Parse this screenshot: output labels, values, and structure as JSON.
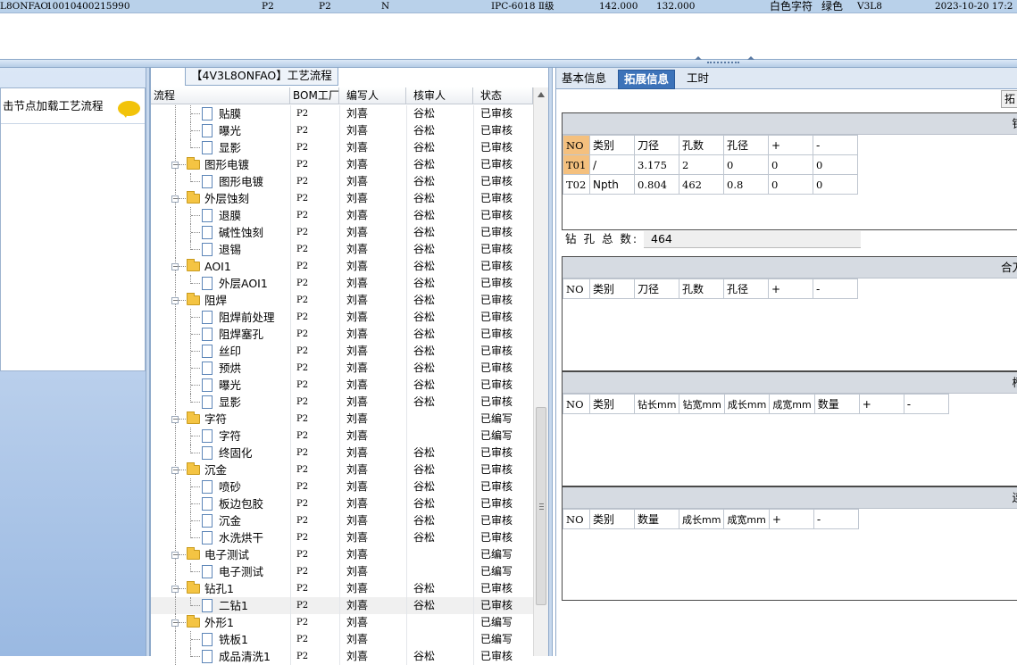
{
  "top_row": {
    "code": "L8ONFAO",
    "number": "10010400215990",
    "f1": "P2",
    "f2": "P2",
    "f3": "N",
    "standard": "IPC-6018 Ⅱ级",
    "v1": "142.000",
    "v2": "132.000",
    "silk": "白色字符",
    "mask": "绿色",
    "version": "V3L8",
    "datetime": "2023-10-20 17:2"
  },
  "left_panel": {
    "hint": "击节点加载工艺流程",
    "icon": "chat-bubble-icon"
  },
  "tree_panel": {
    "title": "【4V3L8ONFAO】工艺流程",
    "columns": {
      "flow": "流程",
      "bom": "BOM工厂",
      "writer": "编写人",
      "checker": "核审人",
      "status": "状态"
    },
    "rows": [
      {
        "name": "贴膜",
        "level": 2,
        "bom": "P2",
        "writer": "刘喜",
        "checker": "谷松",
        "status": "已审核"
      },
      {
        "name": "曝光",
        "level": 2,
        "bom": "P2",
        "writer": "刘喜",
        "checker": "谷松",
        "status": "已审核"
      },
      {
        "name": "显影",
        "level": 2,
        "bom": "P2",
        "writer": "刘喜",
        "checker": "谷松",
        "status": "已审核"
      },
      {
        "name": "图形电镀",
        "level": 1,
        "bom": "P2",
        "writer": "刘喜",
        "checker": "谷松",
        "status": "已审核"
      },
      {
        "name": "图形电镀",
        "level": 2,
        "bom": "P2",
        "writer": "刘喜",
        "checker": "谷松",
        "status": "已审核"
      },
      {
        "name": "外层蚀刻",
        "level": 1,
        "bom": "P2",
        "writer": "刘喜",
        "checker": "谷松",
        "status": "已审核"
      },
      {
        "name": "退膜",
        "level": 2,
        "bom": "P2",
        "writer": "刘喜",
        "checker": "谷松",
        "status": "已审核"
      },
      {
        "name": "碱性蚀刻",
        "level": 2,
        "bom": "P2",
        "writer": "刘喜",
        "checker": "谷松",
        "status": "已审核"
      },
      {
        "name": "退锡",
        "level": 2,
        "bom": "P2",
        "writer": "刘喜",
        "checker": "谷松",
        "status": "已审核"
      },
      {
        "name": "AOI1",
        "level": 1,
        "bom": "P2",
        "writer": "刘喜",
        "checker": "谷松",
        "status": "已审核"
      },
      {
        "name": "外层AOI1",
        "level": 2,
        "bom": "P2",
        "writer": "刘喜",
        "checker": "谷松",
        "status": "已审核"
      },
      {
        "name": "阻焊",
        "level": 1,
        "bom": "P2",
        "writer": "刘喜",
        "checker": "谷松",
        "status": "已审核"
      },
      {
        "name": "阻焊前处理",
        "level": 2,
        "bom": "P2",
        "writer": "刘喜",
        "checker": "谷松",
        "status": "已审核"
      },
      {
        "name": "阻焊塞孔",
        "level": 2,
        "bom": "P2",
        "writer": "刘喜",
        "checker": "谷松",
        "status": "已审核"
      },
      {
        "name": "丝印",
        "level": 2,
        "bom": "P2",
        "writer": "刘喜",
        "checker": "谷松",
        "status": "已审核"
      },
      {
        "name": "预烘",
        "level": 2,
        "bom": "P2",
        "writer": "刘喜",
        "checker": "谷松",
        "status": "已审核"
      },
      {
        "name": "曝光",
        "level": 2,
        "bom": "P2",
        "writer": "刘喜",
        "checker": "谷松",
        "status": "已审核"
      },
      {
        "name": "显影",
        "level": 2,
        "bom": "P2",
        "writer": "刘喜",
        "checker": "谷松",
        "status": "已审核"
      },
      {
        "name": "字符",
        "level": 1,
        "bom": "P2",
        "writer": "刘喜",
        "checker": "",
        "status": "已编写"
      },
      {
        "name": "字符",
        "level": 2,
        "bom": "P2",
        "writer": "刘喜",
        "checker": "",
        "status": "已编写"
      },
      {
        "name": "终固化",
        "level": 2,
        "bom": "P2",
        "writer": "刘喜",
        "checker": "谷松",
        "status": "已审核"
      },
      {
        "name": "沉金",
        "level": 1,
        "bom": "P2",
        "writer": "刘喜",
        "checker": "谷松",
        "status": "已审核"
      },
      {
        "name": "喷砂",
        "level": 2,
        "bom": "P2",
        "writer": "刘喜",
        "checker": "谷松",
        "status": "已审核"
      },
      {
        "name": "板边包胶",
        "level": 2,
        "bom": "P2",
        "writer": "刘喜",
        "checker": "谷松",
        "status": "已审核"
      },
      {
        "name": "沉金",
        "level": 2,
        "bom": "P2",
        "writer": "刘喜",
        "checker": "谷松",
        "status": "已审核"
      },
      {
        "name": "水洗烘干",
        "level": 2,
        "bom": "P2",
        "writer": "刘喜",
        "checker": "谷松",
        "status": "已审核"
      },
      {
        "name": "电子测试",
        "level": 1,
        "bom": "P2",
        "writer": "刘喜",
        "checker": "",
        "status": "已编写"
      },
      {
        "name": "电子测试",
        "level": 2,
        "bom": "P2",
        "writer": "刘喜",
        "checker": "",
        "status": "已编写"
      },
      {
        "name": "钻孔1",
        "level": 1,
        "bom": "P2",
        "writer": "刘喜",
        "checker": "谷松",
        "status": "已审核"
      },
      {
        "name": "二钻1",
        "level": 2,
        "bom": "P2",
        "writer": "刘喜",
        "checker": "谷松",
        "status": "已审核",
        "selected": true
      },
      {
        "name": "外形1",
        "level": 1,
        "bom": "P2",
        "writer": "刘喜",
        "checker": "",
        "status": "已编写"
      },
      {
        "name": "铣板1",
        "level": 2,
        "bom": "P2",
        "writer": "刘喜",
        "checker": "",
        "status": "已编写"
      },
      {
        "name": "成品清洗1",
        "level": 2,
        "bom": "P2",
        "writer": "刘喜",
        "checker": "谷松",
        "status": "已审核"
      }
    ]
  },
  "right_panel": {
    "tabs": [
      "基本信息",
      "拓展信息",
      "工时"
    ],
    "active_tab": 1,
    "tab_button": "拓",
    "drill": {
      "head": "钻",
      "columns": [
        "NO",
        "类别",
        "刀径",
        "孔数",
        "孔径",
        "+",
        "-"
      ],
      "rows": [
        [
          "T01",
          "/",
          "3.175",
          "2",
          "0",
          "0",
          "0"
        ],
        [
          "T02",
          "Npth",
          "0.804",
          "462",
          "0.8",
          "0",
          "0"
        ]
      ],
      "total_label": "钻 孔 总 数:",
      "total_value": "464"
    },
    "combo": {
      "head": "合刀",
      "columns": [
        "NO",
        "类别",
        "刀径",
        "孔数",
        "孔径",
        "+",
        "-"
      ]
    },
    "slot": {
      "head": "槽",
      "columns": [
        "NO",
        "类别",
        "钻长mm",
        "钻宽mm",
        "成长mm",
        "成宽mm",
        "数量",
        "+",
        "-"
      ]
    },
    "other": {
      "head": "连",
      "columns": [
        "NO",
        "类别",
        "数量",
        "成长mm",
        "成宽mm",
        "+",
        "-"
      ]
    }
  }
}
